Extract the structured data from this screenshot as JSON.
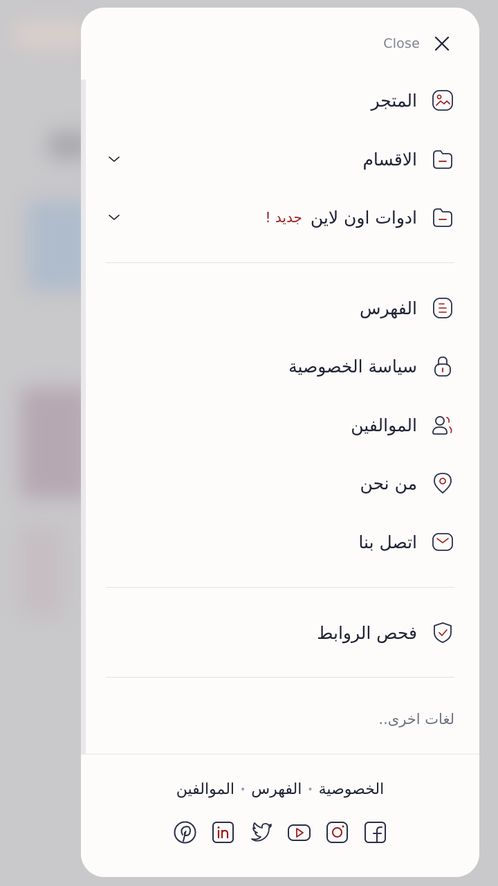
{
  "header": {
    "close_label": "Close"
  },
  "menu": {
    "primary": [
      {
        "label": "المتجر",
        "icon": "gallery-icon",
        "has_chevron": false
      },
      {
        "label": "الاقسام",
        "icon": "folder-icon",
        "has_chevron": true
      },
      {
        "label": "ادوات اون لاين",
        "badge": "جديد !",
        "icon": "folder-icon",
        "has_chevron": true
      }
    ],
    "secondary": [
      {
        "label": "الفهرس",
        "icon": "document-icon"
      },
      {
        "label": "سياسة الخصوصية",
        "icon": "lock-icon"
      },
      {
        "label": "الموالفين",
        "icon": "users-icon"
      },
      {
        "label": "من نحن",
        "icon": "location-icon"
      },
      {
        "label": "اتصل بنا",
        "icon": "mail-icon"
      }
    ],
    "tertiary": [
      {
        "label": "فحص الروابط",
        "icon": "shield-check-icon"
      }
    ],
    "other_languages": "لغات اخرى.."
  },
  "footer": {
    "links": [
      "الخصوصية",
      "الفهرس",
      "الموالفين"
    ],
    "social": [
      "pinterest",
      "linkedin",
      "twitter",
      "youtube",
      "instagram",
      "facebook"
    ]
  },
  "colors": {
    "accent": "#9b1b1b",
    "text": "#1f2233",
    "icon_stroke": "#2a2f45"
  }
}
